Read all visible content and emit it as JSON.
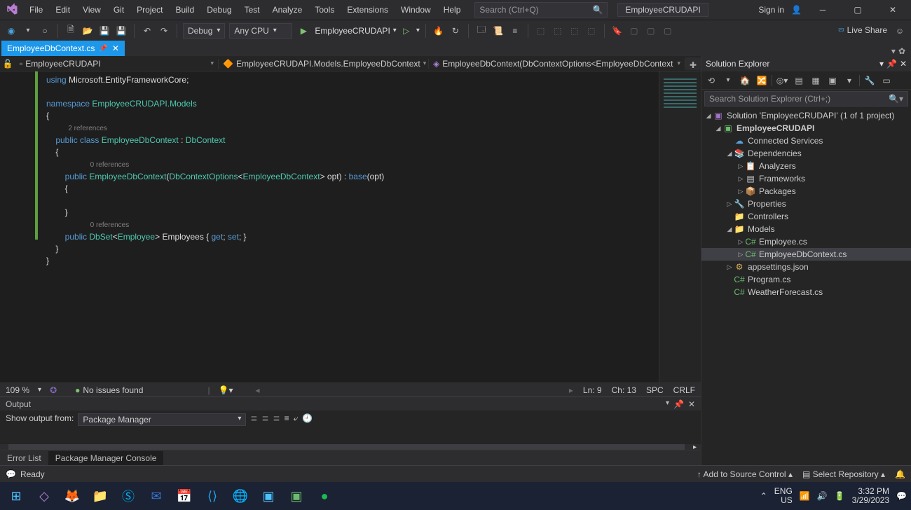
{
  "menu": {
    "file": "File",
    "edit": "Edit",
    "view": "View",
    "git": "Git",
    "project": "Project",
    "build": "Build",
    "debug": "Debug",
    "test": "Test",
    "analyze": "Analyze",
    "tools": "Tools",
    "extensions": "Extensions",
    "window": "Window",
    "help": "Help"
  },
  "search_placeholder": "Search (Ctrl+Q)",
  "project_name": "EmployeeCRUDAPI",
  "signin": "Sign in",
  "liveshare": "Live Share",
  "toolbar": {
    "config": "Debug",
    "platform": "Any CPU",
    "run_target": "EmployeeCRUDAPI"
  },
  "doc_tab": "EmployeeDbContext.cs",
  "breadcrumb": {
    "a": "EmployeeCRUDAPI",
    "b": "EmployeeCRUDAPI.Models.EmployeeDbContext",
    "c": "EmployeeDbContext(DbContextOptions<EmployeeDbContext"
  },
  "code": {
    "l1a": "using ",
    "l1b": "Microsoft.EntityFrameworkCore;",
    "l3a": "namespace ",
    "l3b": "EmployeeCRUDAPI.Models",
    "l4": "{",
    "ref2": "2 references",
    "l5a": "    public class ",
    "l5b": "EmployeeDbContext",
    "l5c": " : ",
    "l5d": "DbContext",
    "l6": "    {",
    "ref0a": "0 references",
    "l7a": "        public ",
    "l7b": "EmployeeDbContext",
    "l7c": "(",
    "l7d": "DbContextOptions",
    "l7e": "<",
    "l7f": "EmployeeDbContext",
    "l7g": "> opt) : ",
    "l7h": "base",
    "l7i": "(opt)",
    "l8": "        {",
    "l9": "",
    "l10": "        }",
    "ref0b": "0 references",
    "l11a": "        public ",
    "l11b": "DbSet",
    "l11c": "<",
    "l11d": "Employee",
    "l11e": "> Employees { ",
    "l11f": "get",
    "l11g": "; ",
    "l11h": "set",
    "l11i": "; }",
    "l12": "    }",
    "l13": "}"
  },
  "editor_status": {
    "zoom": "109 %",
    "issues": "No issues found",
    "ln": "Ln: 9",
    "ch": "Ch: 13",
    "spc": "SPC",
    "crlf": "CRLF"
  },
  "output": {
    "title": "Output",
    "show_from": "Show output from:",
    "source": "Package Manager"
  },
  "bottom_tabs": {
    "errorlist": "Error List",
    "pmc": "Package Manager Console"
  },
  "solexp": {
    "title": "Solution Explorer",
    "search": "Search Solution Explorer (Ctrl+;)",
    "solution": "Solution 'EmployeeCRUDAPI' (1 of 1 project)",
    "proj": "EmployeeCRUDAPI",
    "connected": "Connected Services",
    "deps": "Dependencies",
    "analyzers": "Analyzers",
    "frameworks": "Frameworks",
    "packages": "Packages",
    "properties": "Properties",
    "controllers": "Controllers",
    "models": "Models",
    "employee": "Employee.cs",
    "dbcontext": "EmployeeDbContext.cs",
    "appsettings": "appsettings.json",
    "program": "Program.cs",
    "weather": "WeatherForecast.cs"
  },
  "status": {
    "ready": "Ready",
    "add_source": "Add to Source Control",
    "select_repo": "Select Repository"
  },
  "systray": {
    "lang1": "ENG",
    "lang2": "US",
    "time": "3:32 PM",
    "date": "3/29/2023"
  }
}
